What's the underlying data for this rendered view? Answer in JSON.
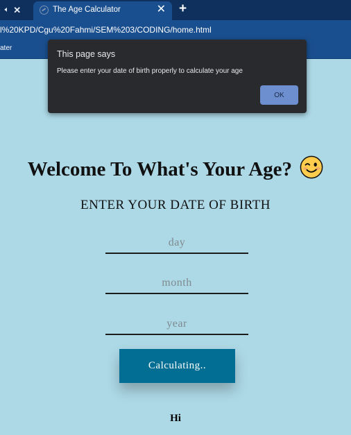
{
  "browser": {
    "active_tab_title": "The Age Calculator",
    "url": "l%20KPD/Cgu%20Fahmi/SEM%203/CODING/home.html",
    "bookmark_label": "ater"
  },
  "dialog": {
    "title": "This page says",
    "message": "Please enter your date of birth properly to calculate your age",
    "ok_label": "OK"
  },
  "page": {
    "heading": "Welcome To What's Your Age?",
    "subtitle": "ENTER YOUR DATE OF BIRTH",
    "inputs": {
      "day_placeholder": "day",
      "month_placeholder": "month",
      "year_placeholder": "year"
    },
    "button_label": "Calculating..",
    "result_text": "Hi"
  },
  "colors": {
    "page_background": "#ADD8E6",
    "button_background": "#026E94",
    "browser_chrome": "#1A4F8F",
    "dialog_background": "#292A2D",
    "dialog_button": "#6D8FD0"
  },
  "icons": [
    "mute-icon",
    "close-icon",
    "globe-icon",
    "new-tab-icon",
    "winking-face-icon"
  ]
}
